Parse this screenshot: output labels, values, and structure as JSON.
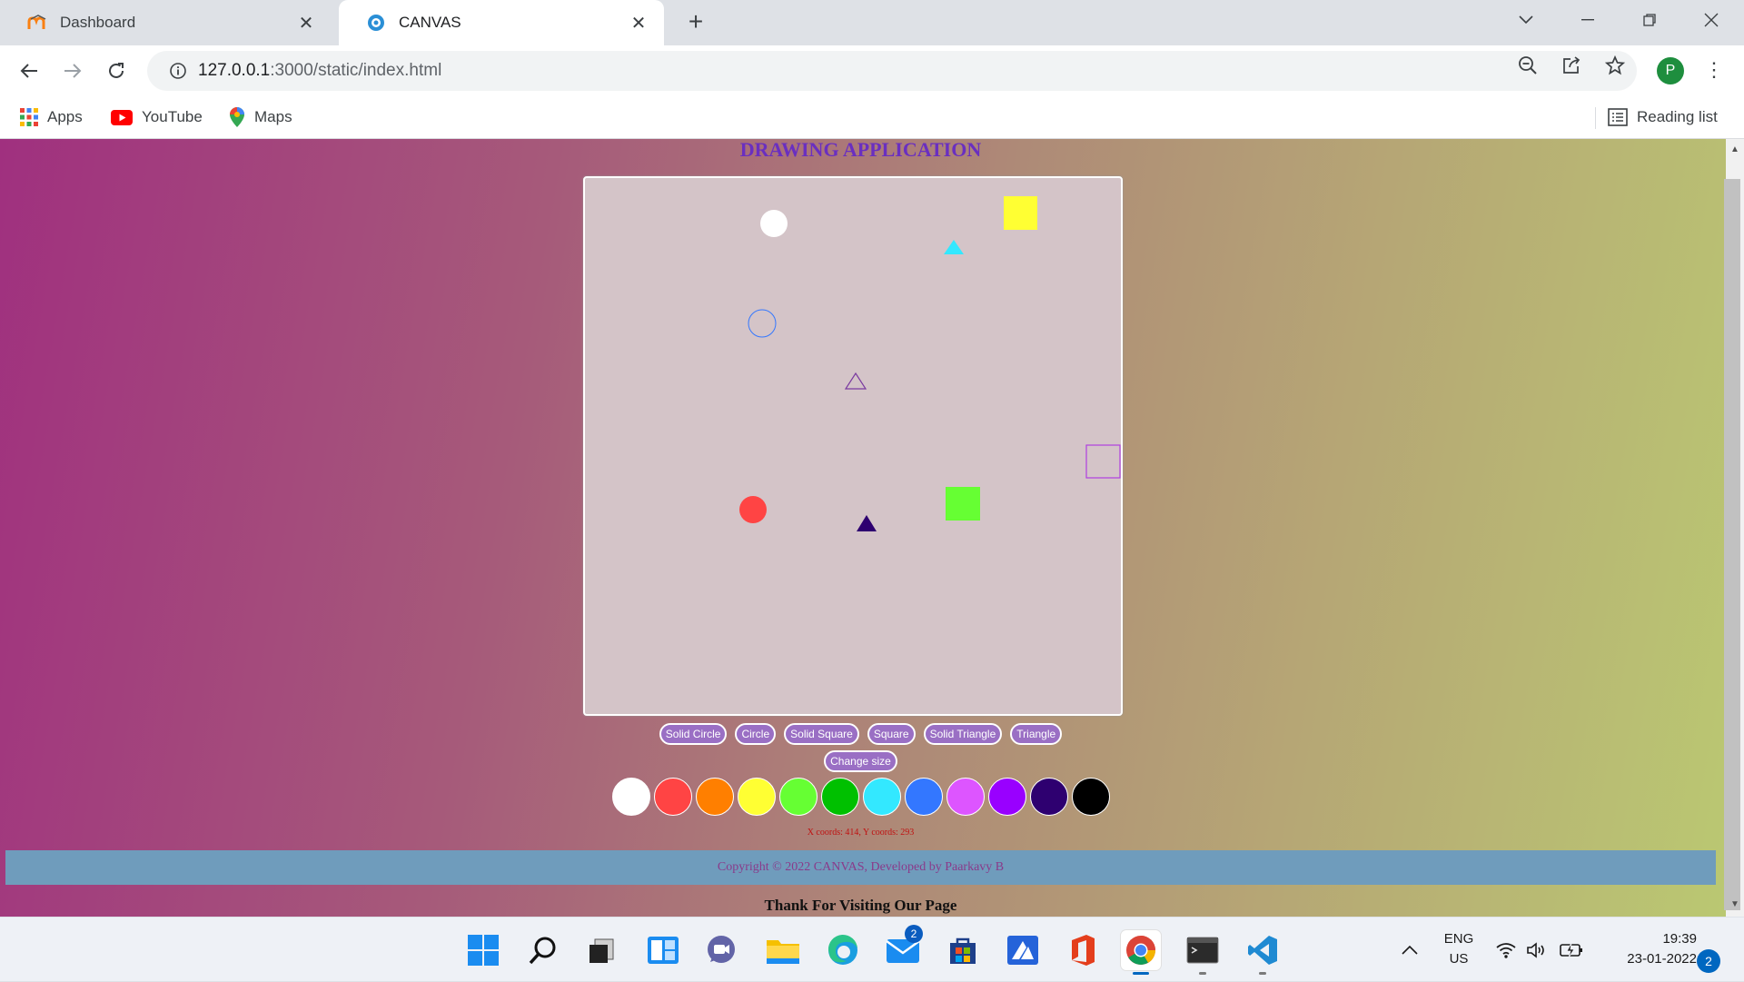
{
  "browser": {
    "tabs": [
      {
        "title": "Dashboard",
        "favicon": "moodle-icon",
        "active": false
      },
      {
        "title": "CANVAS",
        "favicon": "gear-icon",
        "active": true
      }
    ],
    "url_host": "127.0.0.1",
    "url_rest": ":3000/static/index.html",
    "profile_initial": "P",
    "bookmarks": [
      {
        "label": "Apps",
        "icon": "apps-grid-icon"
      },
      {
        "label": "YouTube",
        "icon": "youtube-icon"
      },
      {
        "label": "Maps",
        "icon": "maps-pin-icon"
      }
    ],
    "reading_list": "Reading list"
  },
  "page": {
    "title": "DRAWING APPLICATION",
    "canvas_bg": "#d4c4c8",
    "shape_buttons": [
      "Solid Circle",
      "Circle",
      "Solid Square",
      "Square",
      "Solid Triangle",
      "Triangle"
    ],
    "change_size_button": "Change size",
    "palette": [
      "#ffffff",
      "#ff4444",
      "#ff7f00",
      "#ffff33",
      "#66ff33",
      "#00c000",
      "#33e8ff",
      "#3377ff",
      "#dd55ff",
      "#9900ff",
      "#2e0070",
      "#000000"
    ],
    "coords_text": "X coords: 414, Y coords: 293",
    "footer_text": "Copyright © 2022 CANVAS, Developed by Paarkavy B",
    "thanks_text": "Thank For Visiting Our Page"
  },
  "taskbar": {
    "apps": [
      "start-icon",
      "search-icon",
      "task-view-icon",
      "widgets-icon",
      "teams-chat-icon",
      "file-explorer-icon",
      "edge-icon",
      "mail-icon",
      "store-icon",
      "azure-data-studio-icon",
      "office-icon",
      "chrome-icon",
      "terminal-icon",
      "vscode-icon"
    ],
    "mail_badge": "2",
    "lang_line1": "ENG",
    "lang_line2": "US",
    "time": "19:39",
    "date": "23-01-2022",
    "notifications": "2"
  }
}
